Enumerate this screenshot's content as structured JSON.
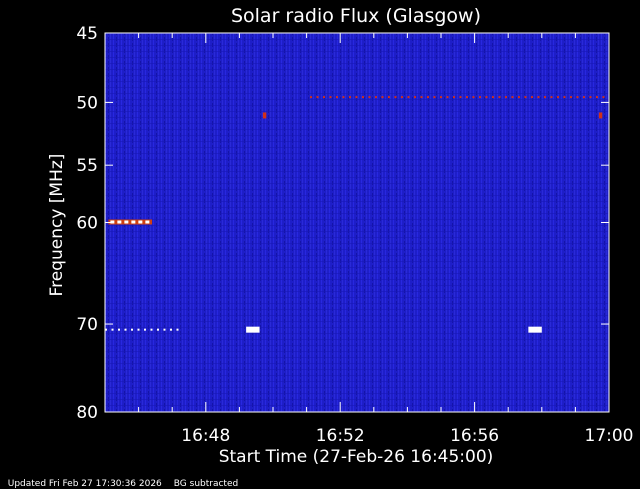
{
  "chart_data": {
    "type": "heatmap",
    "title": "Solar radio Flux (Glasgow)",
    "xlabel": "Start Time (27-Feb-26 16:45:00)",
    "ylabel": "Frequency [MHz]",
    "x_ticks": [
      "16:48",
      "16:52",
      "16:56",
      "17:00"
    ],
    "x_tick_minutes": [
      3,
      7,
      11,
      15
    ],
    "xlim_minutes": [
      0,
      15
    ],
    "y_ticks": [
      45,
      50,
      55,
      60,
      70,
      80
    ],
    "ylim": [
      45,
      80
    ],
    "y_scale": "log",
    "grid": false,
    "colormap": {
      "low": "#1c1cd0",
      "mid": "#d03018",
      "high": "#ffffff"
    },
    "features": [
      {
        "kind": "burst",
        "freq_mhz": 60,
        "minutes": [
          0.1,
          1.4
        ],
        "level": "high"
      },
      {
        "kind": "rfi_line",
        "freq_mhz": 49.6,
        "minutes": [
          6.1,
          14.9
        ],
        "level": "mid"
      },
      {
        "kind": "rfi_line",
        "freq_mhz": 70.6,
        "minutes": [
          0.0,
          2.2
        ],
        "level": "high"
      },
      {
        "kind": "rfi_spot",
        "freq_mhz": 70.6,
        "minutes": [
          4.2,
          4.6
        ],
        "level": "high"
      },
      {
        "kind": "rfi_spot",
        "freq_mhz": 70.6,
        "minutes": [
          12.6,
          13.0
        ],
        "level": "high"
      },
      {
        "kind": "rfi_spot",
        "freq_mhz": 51.0,
        "minutes": [
          4.7,
          4.8
        ],
        "level": "mid"
      },
      {
        "kind": "rfi_spot",
        "freq_mhz": 51.0,
        "minutes": [
          14.7,
          14.8
        ],
        "level": "mid"
      }
    ]
  },
  "footer": {
    "updated": "Updated Fri Feb 27 17:30:36 2026",
    "bg_note": "BG subtracted"
  }
}
